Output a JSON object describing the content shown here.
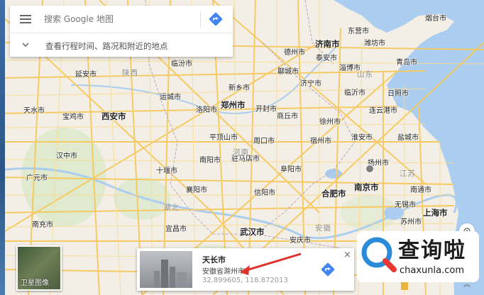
{
  "search": {
    "placeholder": "搜索 Google 地图",
    "explore_label": "查看行程时间、路况和附近的地点"
  },
  "map": {
    "cities": [
      {
        "name": "烟台市"
      },
      {
        "name": "济南市"
      },
      {
        "name": "潍坊市"
      },
      {
        "name": "青岛市"
      },
      {
        "name": "泰安市"
      },
      {
        "name": "济宁市"
      },
      {
        "name": "临沂市"
      },
      {
        "name": "日照市"
      },
      {
        "name": "连云港市"
      },
      {
        "name": "徐州市"
      },
      {
        "name": "郑州市"
      },
      {
        "name": "洛阳市"
      },
      {
        "name": "西安市"
      },
      {
        "name": "运城市"
      },
      {
        "name": "临汾市"
      },
      {
        "name": "商丘市"
      },
      {
        "name": "周口市"
      },
      {
        "name": "驻马店市"
      },
      {
        "name": "南阳市"
      },
      {
        "name": "合肥市"
      },
      {
        "name": "南京市"
      },
      {
        "name": "南通市"
      },
      {
        "name": "无锡市"
      },
      {
        "name": "上海市"
      },
      {
        "name": "苏州市"
      },
      {
        "name": "武汉市"
      },
      {
        "name": "宜昌市"
      },
      {
        "name": "襄阳市"
      },
      {
        "name": "十堰市"
      },
      {
        "name": "汉中市"
      },
      {
        "name": "广元市"
      },
      {
        "name": "南充市"
      },
      {
        "name": "天水市"
      },
      {
        "name": "宝鸡市"
      },
      {
        "name": "延安市"
      },
      {
        "name": "扬州市"
      },
      {
        "name": "淮安市"
      },
      {
        "name": "盐城市"
      },
      {
        "name": "宿州市"
      },
      {
        "name": "阜阳市"
      },
      {
        "name": "安庆市"
      },
      {
        "name": "信阳市"
      },
      {
        "name": "平顶山市"
      },
      {
        "name": "开封市"
      },
      {
        "name": "新乡市"
      },
      {
        "name": "聊城市"
      },
      {
        "name": "德州市"
      },
      {
        "name": "淄博市"
      },
      {
        "name": "东营市"
      }
    ],
    "provinces": [
      {
        "name": "陕西"
      },
      {
        "name": "河南"
      },
      {
        "name": "湖北"
      },
      {
        "name": "安徽"
      },
      {
        "name": "江苏"
      },
      {
        "name": "山东"
      },
      {
        "name": "安徽"
      }
    ]
  },
  "satellite": {
    "label": "卫星图像"
  },
  "place_card": {
    "name": "天长市",
    "address": "安徽省滁州市",
    "coords": "32.899605, 118.872013",
    "close": "×"
  },
  "watermark": {
    "text": "查询啦",
    "sub": "chaxunla.com"
  },
  "colors": {
    "land": "#f3efe6",
    "water": "#abcdef",
    "road": "#f6c95e",
    "accent": "#4285f4",
    "arrow": "#e0312c"
  }
}
